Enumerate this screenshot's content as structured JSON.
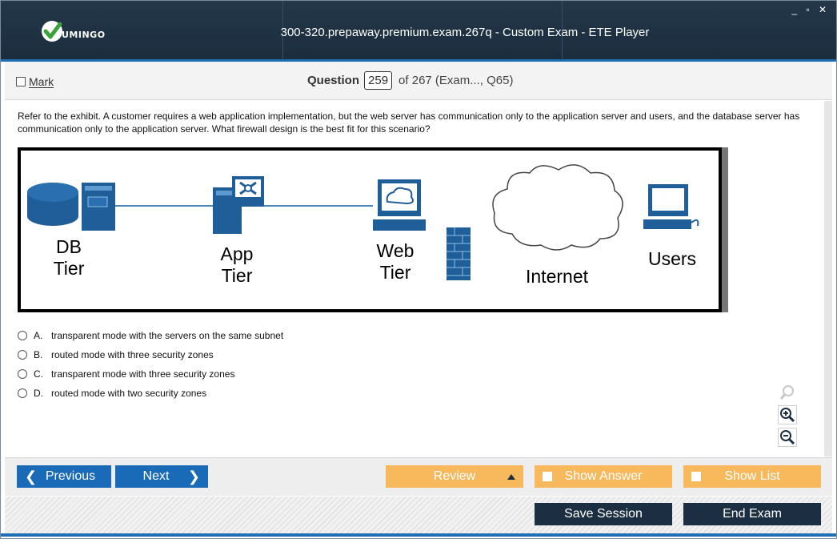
{
  "window": {
    "title": "300-320.prepaway.premium.exam.267q - Custom Exam - ETE Player",
    "logo_text": "UMINGO",
    "controls": "_ ▫ ✕"
  },
  "header": {
    "mark_label": "Mark",
    "question_label": "Question",
    "question_number": "259",
    "question_of": "of 267 (Exam..., Q65)"
  },
  "question": {
    "text": "Refer to the exhibit. A customer requires a web application implementation, but the web server has communication only to the application server and users, and the database server has communication only to the application server. What firewall design is the best fit for this scenario?"
  },
  "exhibit": {
    "db_label_1": "DB",
    "db_label_2": "Tier",
    "app_label_1": "App",
    "app_label_2": "Tier",
    "web_label_1": "Web",
    "web_label_2": "Tier",
    "internet_label": "Internet",
    "users_label": "Users"
  },
  "answers": [
    {
      "letter": "A.",
      "text": "transparent mode with the servers on the same subnet"
    },
    {
      "letter": "B.",
      "text": "routed mode with three security zones"
    },
    {
      "letter": "C.",
      "text": "transparent mode with three security zones"
    },
    {
      "letter": "D.",
      "text": "routed mode with two security zones"
    }
  ],
  "nav": {
    "previous": "Previous",
    "next": "Next",
    "review": "Review",
    "show_answer": "Show Answer",
    "show_list": "Show List"
  },
  "footer": {
    "save_session": "Save Session",
    "end_exam": "End Exam"
  },
  "colors": {
    "title_bg": "#1b2d3d",
    "accent_blue": "#1a6bb7",
    "accent_orange": "#f8b85c",
    "dark_button": "#1c2f42",
    "logo_green": "#3aa13a"
  },
  "icons": [
    "check-logo-icon",
    "zoom-reset-icon",
    "zoom-in-icon",
    "zoom-out-icon",
    "chevron-left-icon",
    "chevron-right-icon",
    "triangle-up-icon"
  ]
}
